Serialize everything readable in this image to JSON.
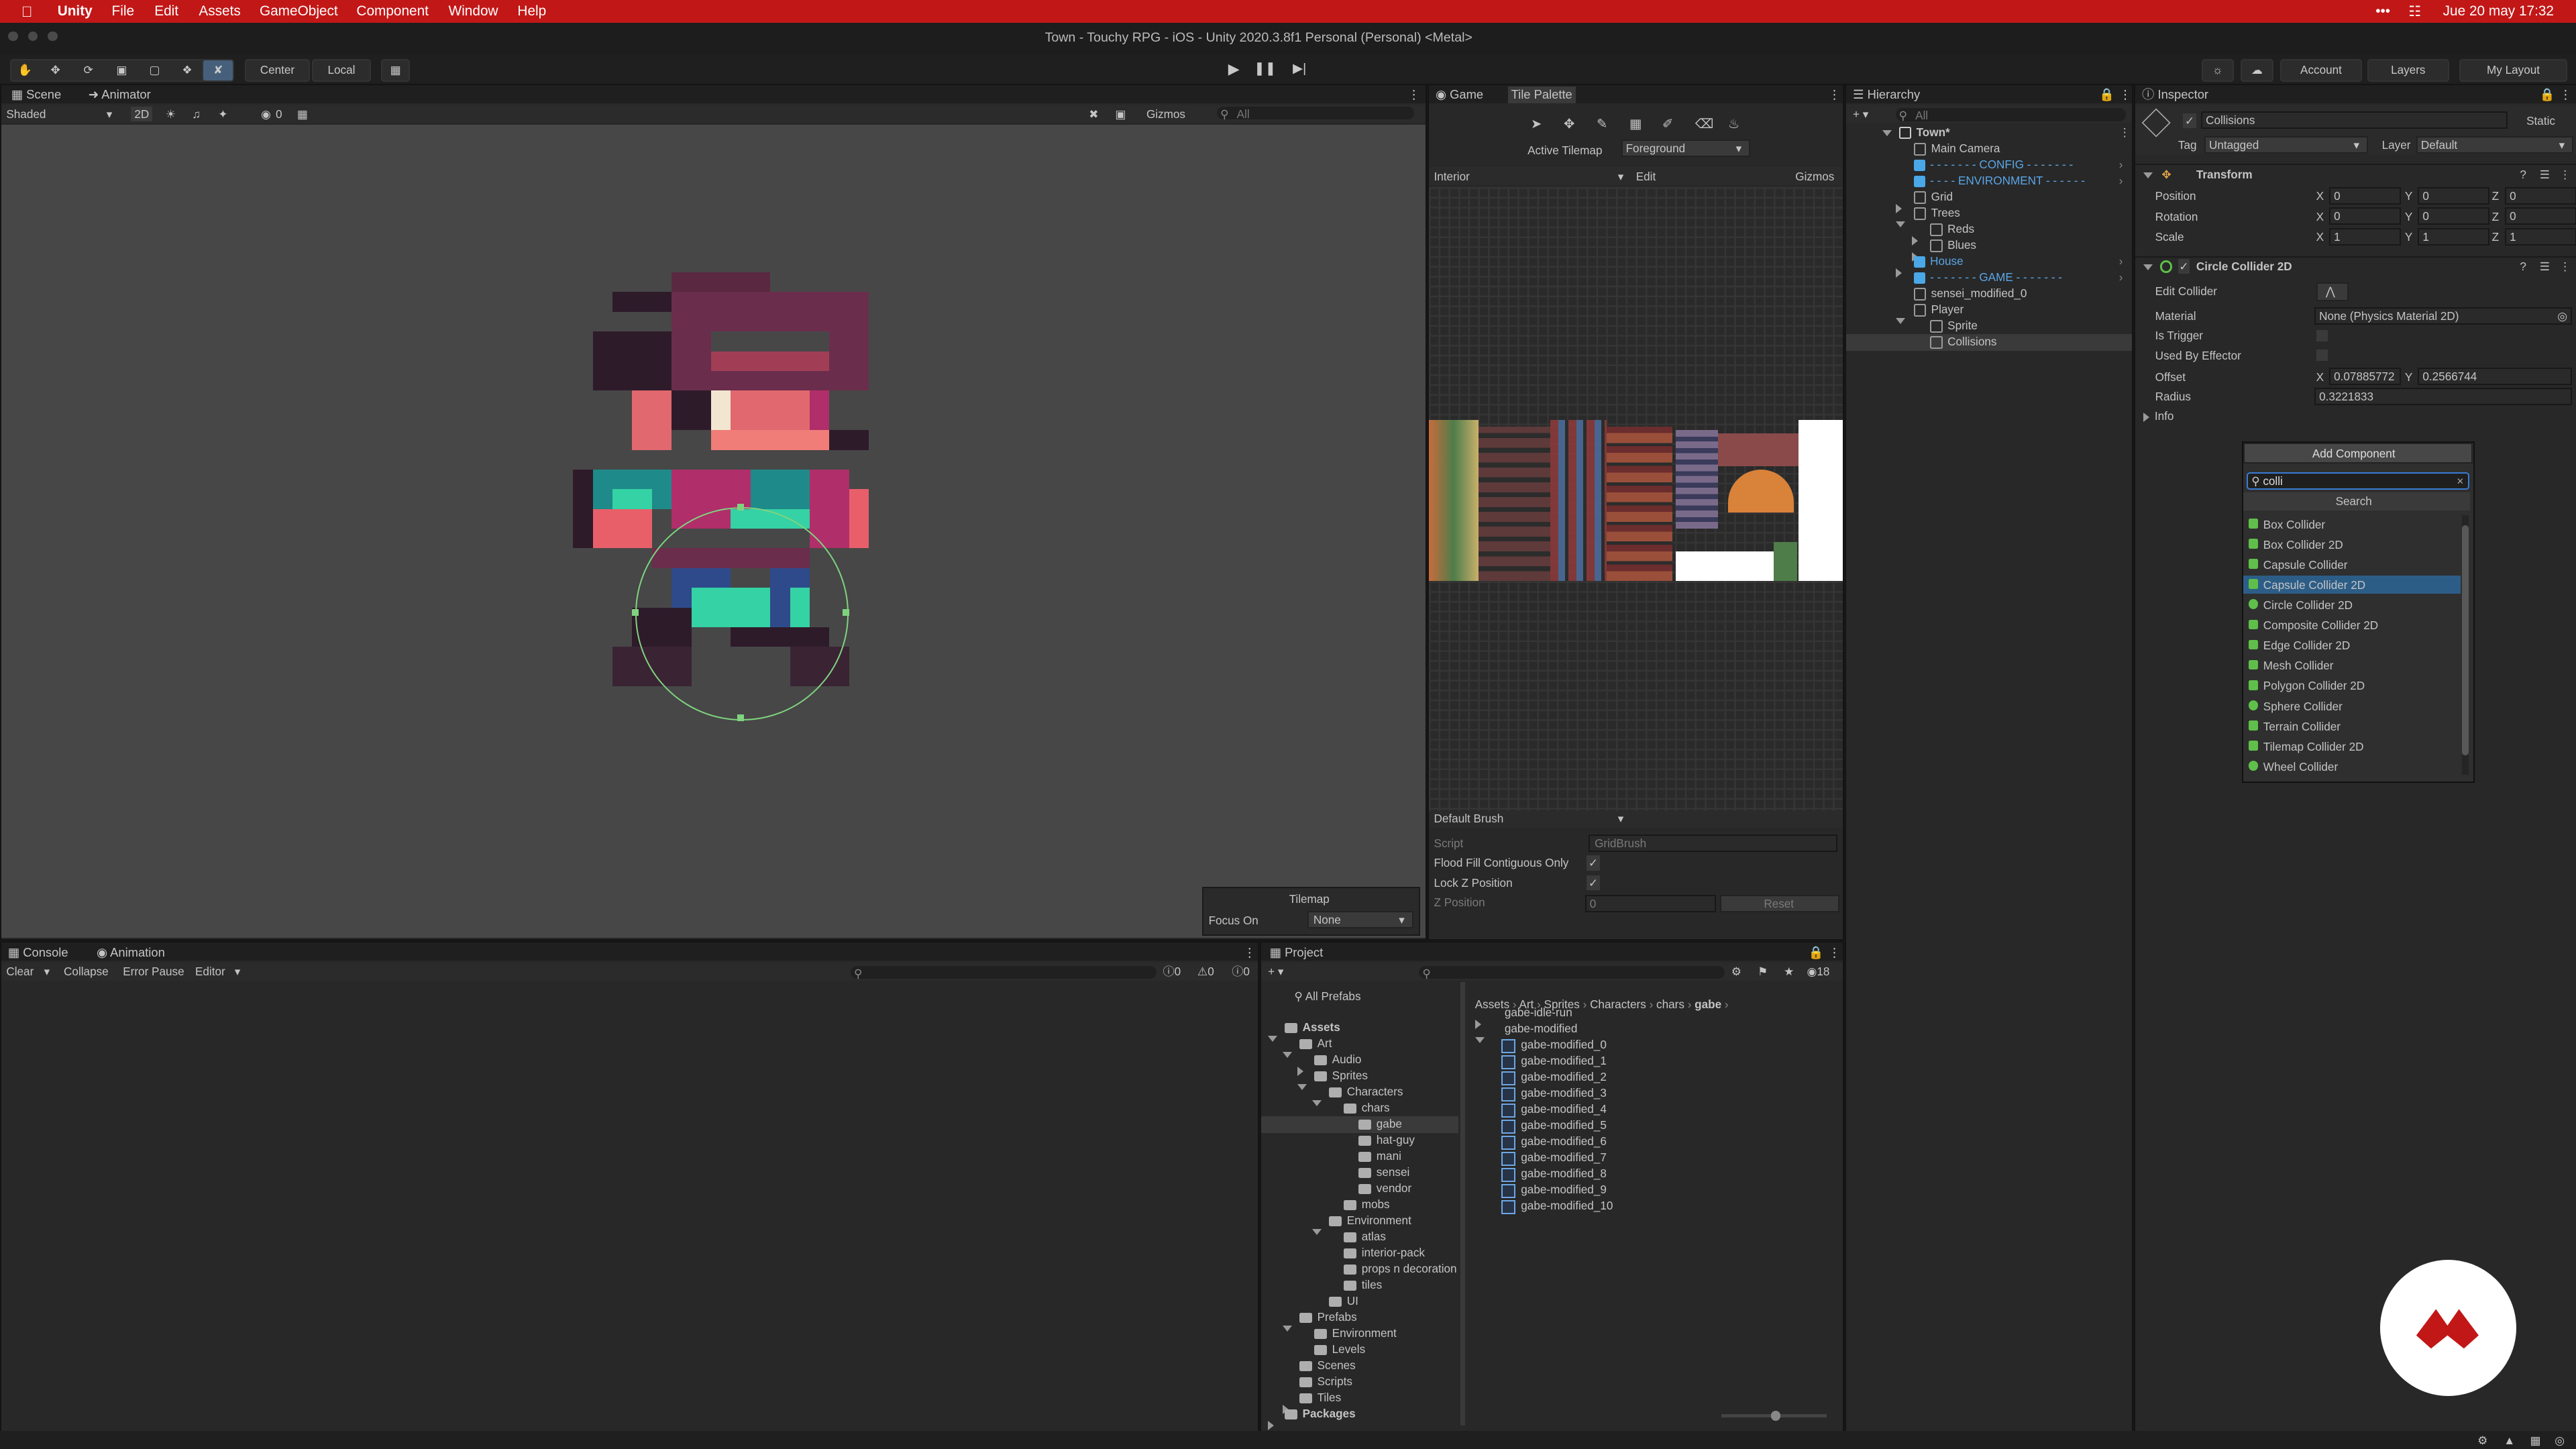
{
  "menubar": {
    "app": "Unity",
    "items": [
      "File",
      "Edit",
      "Assets",
      "GameObject",
      "Component",
      "Window",
      "Help"
    ],
    "datetime": "Jue 20 may  17:32"
  },
  "window_title": "Town - Touchy RPG - iOS - Unity 2020.3.8f1 Personal (Personal) <Metal>",
  "toolbar": {
    "pivot": "Center",
    "space": "Local",
    "account": "Account",
    "layers": "Layers",
    "layout": "My Layout"
  },
  "scene": {
    "tabs": [
      "Scene",
      "Animator"
    ],
    "shading": "Shaded",
    "mode_2d": "2D",
    "hidden_count": "0",
    "gizmos": "Gizmos",
    "search_placeholder": "All",
    "overlay": {
      "title": "Tilemap",
      "focus_label": "Focus On",
      "focus_value": "None"
    }
  },
  "game": {
    "tabs": [
      "Game",
      "Tile Palette"
    ],
    "active_tilemap_label": "Active Tilemap",
    "active_tilemap_value": "Foreground",
    "palette": "Interior",
    "edit": "Edit",
    "gizmos": "Gizmos",
    "brush": "Default Brush",
    "script_label": "Script",
    "script_value": "GridBrush",
    "flood_fill": "Flood Fill Contiguous Only",
    "lock_z": "Lock Z Position",
    "z_position": "Z Position",
    "z_value": "0",
    "reset": "Reset"
  },
  "hierarchy": {
    "title": "Hierarchy",
    "search_placeholder": "All",
    "scene_name": "Town*",
    "items": [
      {
        "label": "Main Camera",
        "depth": 1,
        "type": "cube"
      },
      {
        "label": "- - - - - - - CONFIG - - - - - - -",
        "depth": 1,
        "type": "prefab",
        "blue": true
      },
      {
        "label": "- - - - ENVIRONMENT - - - - - -",
        "depth": 1,
        "type": "prefab",
        "blue": true
      },
      {
        "label": "Grid",
        "depth": 1,
        "type": "cube",
        "arrow": "right"
      },
      {
        "label": "Trees",
        "depth": 1,
        "type": "cube",
        "arrow": "down"
      },
      {
        "label": "Reds",
        "depth": 2,
        "type": "cube",
        "arrow": "right"
      },
      {
        "label": "Blues",
        "depth": 2,
        "type": "cube",
        "arrow": "right"
      },
      {
        "label": "House",
        "depth": 1,
        "type": "prefab",
        "arrow": "right",
        "blue": true
      },
      {
        "label": "- - - - - - - GAME - - - - - - -",
        "depth": 1,
        "type": "prefab",
        "blue": true
      },
      {
        "label": "sensei_modified_0",
        "depth": 1,
        "type": "cube"
      },
      {
        "label": "Player",
        "depth": 1,
        "type": "cube",
        "arrow": "down"
      },
      {
        "label": "Sprite",
        "depth": 2,
        "type": "cube"
      },
      {
        "label": "Collisions",
        "depth": 2,
        "type": "cube",
        "selected": true
      }
    ]
  },
  "inspector": {
    "title": "Inspector",
    "object_name": "Collisions",
    "static": "Static",
    "tag_label": "Tag",
    "tag_value": "Untagged",
    "layer_label": "Layer",
    "layer_value": "Default",
    "transform": {
      "title": "Transform",
      "position": {
        "label": "Position",
        "x": "0",
        "y": "0",
        "z": "0"
      },
      "rotation": {
        "label": "Rotation",
        "x": "0",
        "y": "0",
        "z": "0"
      },
      "scale": {
        "label": "Scale",
        "x": "1",
        "y": "1",
        "z": "1"
      }
    },
    "collider": {
      "title": "Circle Collider 2D",
      "edit_collider": "Edit Collider",
      "material_label": "Material",
      "material_value": "None (Physics Material 2D)",
      "is_trigger": "Is Trigger",
      "used_by_effector": "Used By Effector",
      "offset_label": "Offset",
      "offset_x": "0.07885772",
      "offset_y": "0.2566744",
      "radius_label": "Radius",
      "radius_value": "0.3221833",
      "info": "Info"
    },
    "add_component": "Add Component",
    "search_value": "colli",
    "search_title": "Search",
    "results": [
      {
        "label": "Box Collider",
        "color": "#5fbf4a"
      },
      {
        "label": "Box Collider 2D",
        "color": "#5fbf4a"
      },
      {
        "label": "Capsule Collider",
        "color": "#5fbf4a"
      },
      {
        "label": "Capsule Collider 2D",
        "color": "#5fbf4a",
        "selected": true
      },
      {
        "label": "Circle Collider 2D",
        "color": "#5fbf4a"
      },
      {
        "label": "Composite Collider 2D",
        "color": "#5fbf4a"
      },
      {
        "label": "Edge Collider 2D",
        "color": "#5fbf4a"
      },
      {
        "label": "Mesh Collider",
        "color": "#5fbf4a"
      },
      {
        "label": "Polygon Collider 2D",
        "color": "#5fbf4a"
      },
      {
        "label": "Sphere Collider",
        "color": "#5fbf4a"
      },
      {
        "label": "Terrain Collider",
        "color": "#5fbf4a"
      },
      {
        "label": "Tilemap Collider 2D",
        "color": "#5fbf4a"
      },
      {
        "label": "Wheel Collider",
        "color": "#5fbf4a"
      }
    ]
  },
  "console": {
    "tabs": [
      "Console",
      "Animation"
    ],
    "buttons": [
      "Clear",
      "Collapse",
      "Error Pause",
      "Editor"
    ],
    "counts": [
      "0",
      "0",
      "0"
    ]
  },
  "project": {
    "title": "Project",
    "count": "18",
    "all_prefabs": "All Prefabs",
    "breadcrumb": [
      "Assets",
      "Art",
      "Sprites",
      "Characters",
      "chars",
      "gabe"
    ],
    "tree": [
      {
        "label": "Assets",
        "depth": 0,
        "arrow": "down",
        "bold": true
      },
      {
        "label": "Art",
        "depth": 1,
        "arrow": "down"
      },
      {
        "label": "Audio",
        "depth": 2,
        "arrow": "right"
      },
      {
        "label": "Sprites",
        "depth": 2,
        "arrow": "down"
      },
      {
        "label": "Characters",
        "depth": 3,
        "arrow": "down"
      },
      {
        "label": "chars",
        "depth": 4,
        "arrow": "down"
      },
      {
        "label": "gabe",
        "depth": 5,
        "selected": true
      },
      {
        "label": "hat-guy",
        "depth": 5
      },
      {
        "label": "mani",
        "depth": 5
      },
      {
        "label": "sensei",
        "depth": 5
      },
      {
        "label": "vendor",
        "depth": 5
      },
      {
        "label": "mobs",
        "depth": 4
      },
      {
        "label": "Environment",
        "depth": 3,
        "arrow": "down"
      },
      {
        "label": "atlas",
        "depth": 4
      },
      {
        "label": "interior-pack",
        "depth": 4
      },
      {
        "label": "props n decoration",
        "depth": 4
      },
      {
        "label": "tiles",
        "depth": 4
      },
      {
        "label": "UI",
        "depth": 3
      },
      {
        "label": "Prefabs",
        "depth": 1,
        "arrow": "down"
      },
      {
        "label": "Environment",
        "depth": 2
      },
      {
        "label": "Levels",
        "depth": 2
      },
      {
        "label": "Scenes",
        "depth": 1
      },
      {
        "label": "Scripts",
        "depth": 1
      },
      {
        "label": "Tiles",
        "depth": 1,
        "arrow": "right"
      },
      {
        "label": "Packages",
        "depth": 0,
        "arrow": "right",
        "bold": true
      }
    ],
    "files_header": [
      {
        "label": "gabe-idle-run",
        "arrow": "right"
      },
      {
        "label": "gabe-modified",
        "arrow": "down"
      }
    ],
    "files": [
      "gabe-modified_0",
      "gabe-modified_1",
      "gabe-modified_2",
      "gabe-modified_3",
      "gabe-modified_4",
      "gabe-modified_5",
      "gabe-modified_6",
      "gabe-modified_7",
      "gabe-modified_8",
      "gabe-modified_9",
      "gabe-modified_10"
    ]
  },
  "colors": {
    "menubar": "#c21717",
    "accent_blue": "#2c5d87",
    "selected_row": "#2c5d87",
    "collider_green": "#7fd37f"
  }
}
